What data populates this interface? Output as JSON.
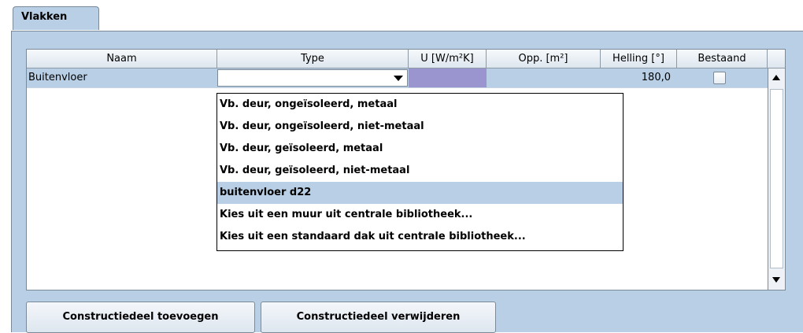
{
  "tabs": [
    {
      "label": "Vlakken"
    }
  ],
  "table": {
    "headers": [
      "Naam",
      "Type",
      "U [W/m²K]",
      "Opp. [m²]",
      "Helling [°]",
      "Bestaand"
    ],
    "rows": [
      {
        "naam": "Buitenvloer",
        "type": "",
        "u": "",
        "opp": "",
        "helling": "180,0",
        "bestaand": false
      }
    ]
  },
  "dropdown": {
    "options": [
      "Vb. deur, ongeïsoleerd, metaal",
      "Vb. deur, ongeïsoleerd, niet-metaal",
      "Vb. deur, geïsoleerd, metaal",
      "Vb. deur, geïsoleerd, niet-metaal",
      "buitenvloer d22",
      "Kies uit een muur uit centrale bibliotheek...",
      "Kies uit een standaard dak uit centrale bibliotheek..."
    ],
    "selected_index": 4
  },
  "buttons": {
    "add": "Constructiedeel toevoegen",
    "remove": "Constructiedeel verwijderen"
  },
  "colors": {
    "panel": "#b8cfe5",
    "u_cell": "#9b95cf",
    "selection": "#b8cfe5"
  }
}
